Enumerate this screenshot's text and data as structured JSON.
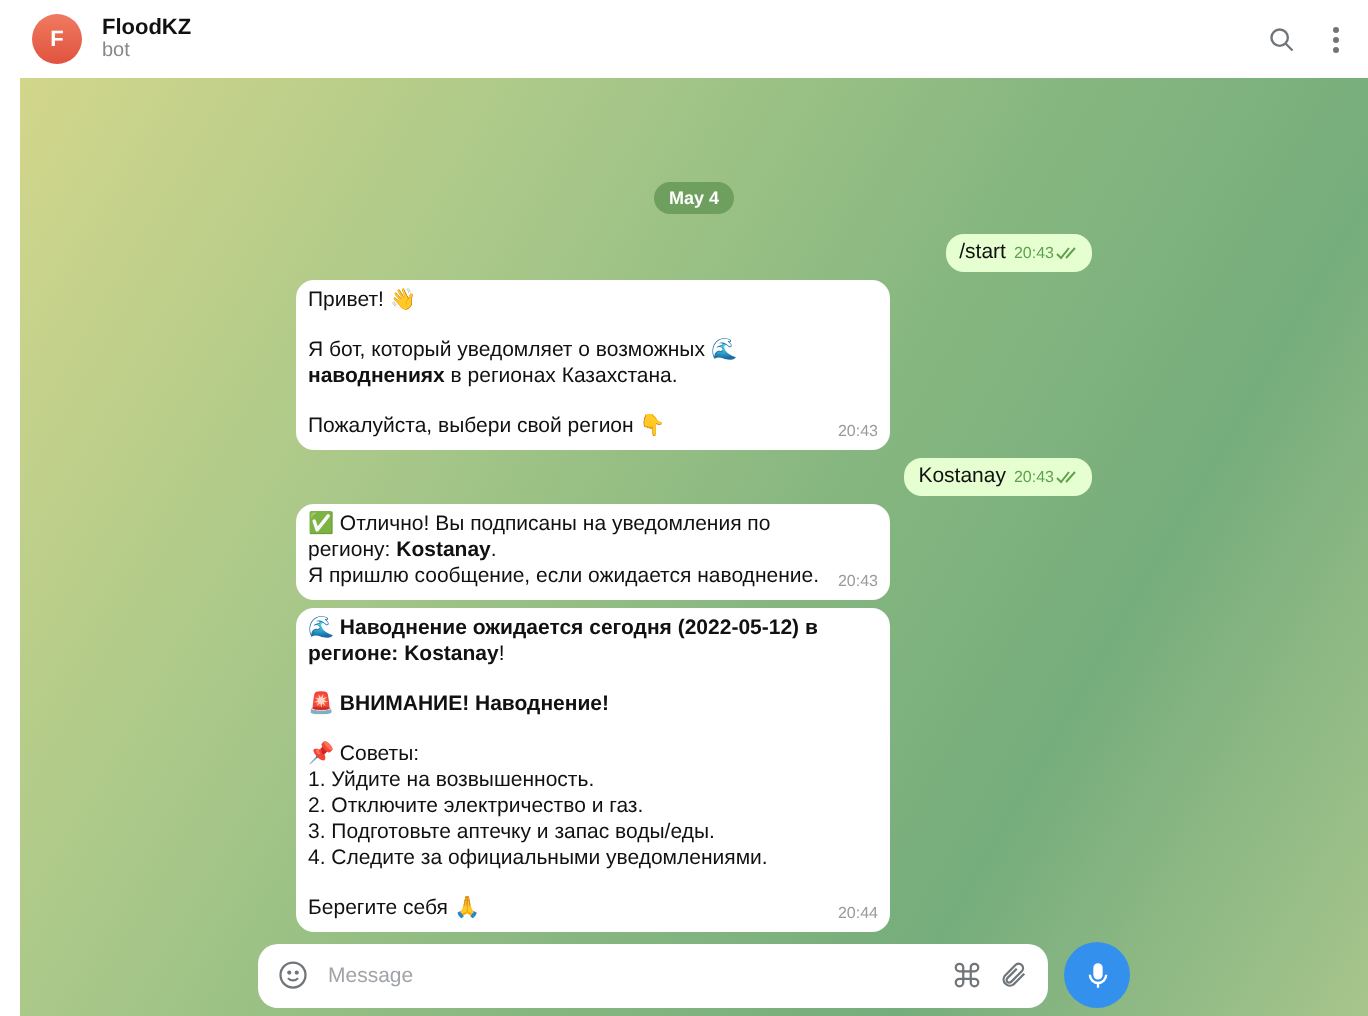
{
  "header": {
    "avatar_letter": "F",
    "title": "FloodKZ",
    "subtitle": "bot"
  },
  "date": "May 4",
  "messages": [
    {
      "kind": "outgoing",
      "paragraphs": [
        "/start"
      ],
      "time": "20:43",
      "read": true
    },
    {
      "kind": "incoming",
      "paragraphs": [
        "Привет! 👋",
        "Я бот, который уведомляет о возможных 🌊 **наводнениях** в регионах Казахстана.",
        "Пожалуйста, выбери свой регион 👇"
      ],
      "time": "20:43"
    },
    {
      "kind": "outgoing",
      "paragraphs": [
        "Kostanay"
      ],
      "time": "20:43",
      "read": true
    },
    {
      "kind": "incoming",
      "paragraphs": [
        "✅ Отлично! Вы подписаны на уведомления по региону: **Kostanay**.\nЯ пришлю сообщение, если ожидается наводнение."
      ],
      "time": "20:43"
    },
    {
      "kind": "incoming",
      "paragraphs": [
        "🌊 **Наводнение ожидается сегодня (2022-05-12) в регионе: Kostanay**!",
        "🚨 **ВНИМАНИЕ! Наводнение!**",
        "📌 Советы:\n1. Уйдите на возвышенность.\n2. Отключите электричество и газ.\n3. Подготовьте аптечку и запас воды/еды.\n4. Следите за официальными уведомлениями.",
        "Берегите себя 🙏"
      ],
      "time": "20:44"
    }
  ],
  "composer": {
    "placeholder": "Message"
  }
}
